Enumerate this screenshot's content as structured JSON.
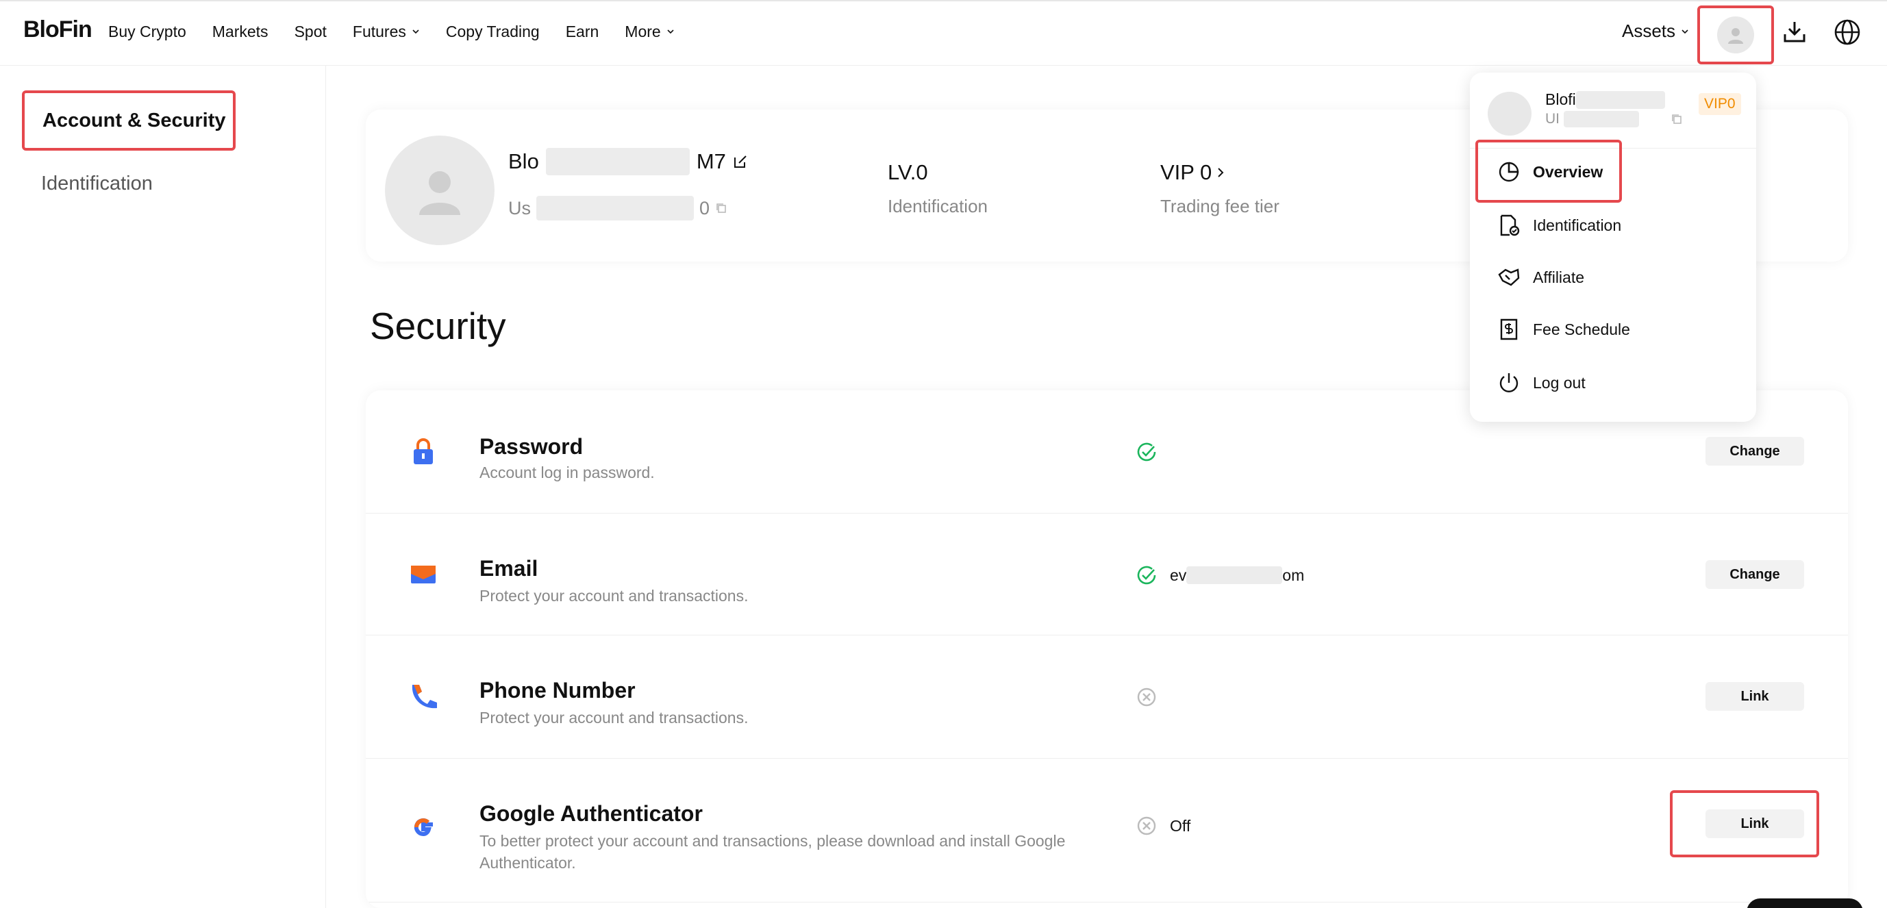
{
  "brand": {
    "logo": "BloFin"
  },
  "nav": [
    {
      "label": "Buy Crypto",
      "dropdown": false
    },
    {
      "label": "Markets",
      "dropdown": false
    },
    {
      "label": "Spot",
      "dropdown": false
    },
    {
      "label": "Futures",
      "dropdown": true
    },
    {
      "label": "Copy Trading",
      "dropdown": false
    },
    {
      "label": "Earn",
      "dropdown": false
    },
    {
      "label": "More",
      "dropdown": true
    }
  ],
  "header": {
    "assets_label": "Assets"
  },
  "sidebar": {
    "items": [
      {
        "label": "Account & Security",
        "active": true
      },
      {
        "label": "Identification",
        "active": false
      }
    ]
  },
  "profile": {
    "name_start": "Blo",
    "name_end": "M7",
    "uid_start": "Us",
    "uid_end": "0",
    "level": "LV.0",
    "level_label": "Identification",
    "vip": "VIP 0",
    "vip_label": "Trading fee tier"
  },
  "security": {
    "title": "Security",
    "rows": [
      {
        "title": "Password",
        "desc": "Account log in password.",
        "status": "ok",
        "status_text": "",
        "button": "Change"
      },
      {
        "title": "Email",
        "desc": "Protect your account and transactions.",
        "status": "ok",
        "status_text_start": "ev",
        "status_text_end": "om",
        "button": "Change"
      },
      {
        "title": "Phone Number",
        "desc": "Protect your account and transactions.",
        "status": "off",
        "status_text": "",
        "button": "Link"
      },
      {
        "title": "Google Authenticator",
        "desc": "To better protect your account and transactions, please download and install Google Authenticator.",
        "status": "off",
        "status_text": "Off",
        "button": "Link"
      }
    ]
  },
  "dropdown": {
    "name_start": "Blofi",
    "uid_start": "UI",
    "vip_badge": "VIP0",
    "items": [
      {
        "label": "Overview",
        "icon": "pie-chart-icon"
      },
      {
        "label": "Identification",
        "icon": "id-document-icon"
      },
      {
        "label": "Affiliate",
        "icon": "handshake-icon"
      },
      {
        "label": "Fee Schedule",
        "icon": "fee-receipt-icon"
      },
      {
        "label": "Log out",
        "icon": "power-icon"
      }
    ]
  },
  "colors": {
    "accent_red": "#e5484d",
    "success_green": "#1bb55c",
    "vip_orange": "#f08c00"
  }
}
